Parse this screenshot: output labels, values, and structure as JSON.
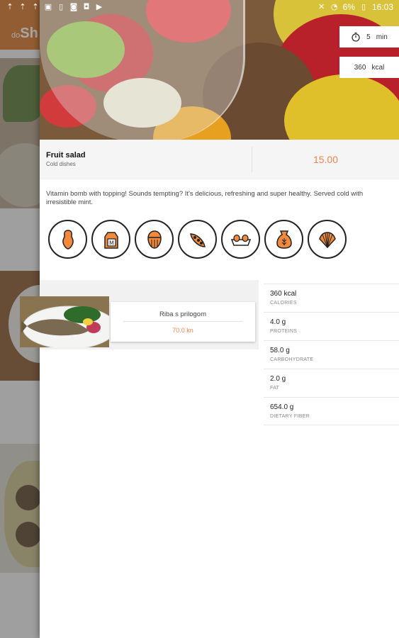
{
  "status_bar": {
    "battery_percent": "6%",
    "time": "16:03"
  },
  "background_app": {
    "logo_small": "do",
    "logo_big": "Sh"
  },
  "recipe": {
    "prep_time": "5",
    "prep_time_unit": "min",
    "calories": "360",
    "calories_unit": "kcal",
    "name": "Fruit salad",
    "category": "Cold dishes",
    "price": "15.00",
    "description": "Vitamin bomb with topping! Sounds tempting?  It's delicious, refreshing and super healthy. Served cold with irresistible mint."
  },
  "allergens": [
    {
      "icon": "peanut-icon"
    },
    {
      "icon": "milk-carton-icon"
    },
    {
      "icon": "nut-icon"
    },
    {
      "icon": "pod-icon"
    },
    {
      "icon": "eggs-icon"
    },
    {
      "icon": "flour-sack-icon"
    },
    {
      "icon": "shell-icon"
    }
  ],
  "related_dish": {
    "name": "Riba s prilogom",
    "price": "70.0 kn"
  },
  "nutrition": [
    {
      "value": "360 kcal",
      "label": "CALORIES"
    },
    {
      "value": "4.0 g",
      "label": "PROTEINS"
    },
    {
      "value": "58.0 g",
      "label": "CARBOHYDRATE"
    },
    {
      "value": "2.0 g",
      "label": "FAT"
    },
    {
      "value": "654.0 g",
      "label": "DIETARY FIBER"
    }
  ],
  "colors": {
    "accent": "#f0844a",
    "icon_orange": "#f28a3c",
    "brand_toolbar": "#d9792b"
  }
}
